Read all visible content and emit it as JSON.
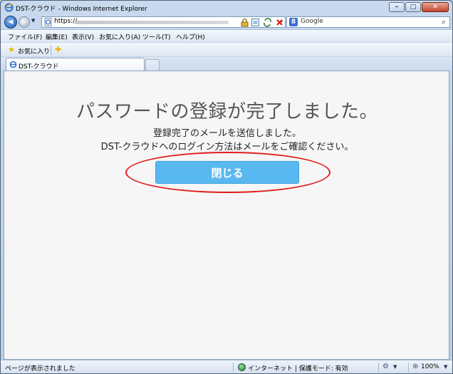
{
  "window": {
    "title": "DST-クラウド - Windows Internet Explorer",
    "minimize_glyph": "–",
    "maximize_glyph": "□",
    "close_glyph": "✕"
  },
  "address": {
    "url": "https://",
    "dropdown_glyph": "▾"
  },
  "search": {
    "placeholder": "Google",
    "go_glyph": "⌕"
  },
  "menu": {
    "items": [
      "ファイル(F)",
      "編集(E)",
      "表示(V)",
      "お気に入り(A)",
      "ツール(T)",
      "ヘルプ(H)"
    ]
  },
  "favorites": {
    "label": "お気に入り"
  },
  "tabs": {
    "active_label": "DST-クラウド"
  },
  "content": {
    "headline": "パスワードの登録が完了しました。",
    "message_line1": "登録完了のメールを送信しました。",
    "message_line2": "DST-クラウドへのログイン方法はメールをご確認ください。",
    "close_button": "閉じる",
    "button_color": "#5ab8f0",
    "annotation_color": "#e21b1b"
  },
  "status": {
    "text": "ページが表示されました",
    "zone": "インターネット | 保護モード: 有効",
    "zoom": "100%"
  }
}
